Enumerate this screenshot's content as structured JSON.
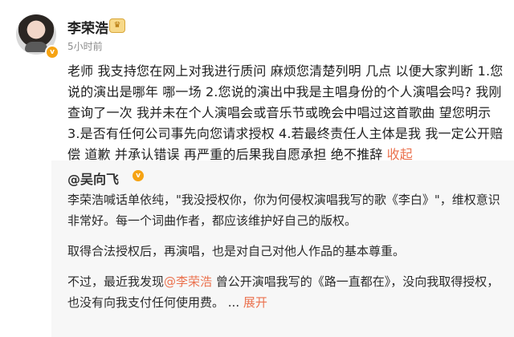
{
  "post": {
    "author": "李荣浩",
    "time": "5小时前",
    "text": "老师 我支持您在网上对我进行质问 麻烦您清楚列明 几点  以便大家判断 1.您说的演出是哪年 哪一场  2.您说的演出中我是主唱身份的个人演唱会吗? 我刚查询了一次 我并未在个人演唱会或音乐节或晚会中唱过这首歌曲 望您明示 3.是否有任何公司事先向您请求授权  4.若最终责任人主体是我 我一定公开赔偿 道歉 并承认错误 再严重的后果我自愿承担 绝不推辞 ",
    "collapse_label": "收起"
  },
  "repost": {
    "author": "@吴向飞",
    "paragraph1": "李荣浩喊话单依纯，\"我没授权你，你为何侵权演唱我写的歌《李白》\"，维权意识非常好。每一个词曲作者，都应该维护好自己的版权。",
    "paragraph2": "取得合法授权后，再演唱，也是对自己对他人作品的基本尊重。",
    "paragraph3_prefix": "不过，最近我发现",
    "mention": "@李荣浩",
    "paragraph3_suffix": " 曾公开演唱我写的《路一直都在》，没向我取得授权，也没有向我支付任何使用费。",
    "expand_label": "展开"
  },
  "icons": {
    "verified": "verified-badge-icon",
    "vip": "vip-crown-icon"
  },
  "colors": {
    "link": "#eb7350",
    "badge": "#f6a313"
  }
}
